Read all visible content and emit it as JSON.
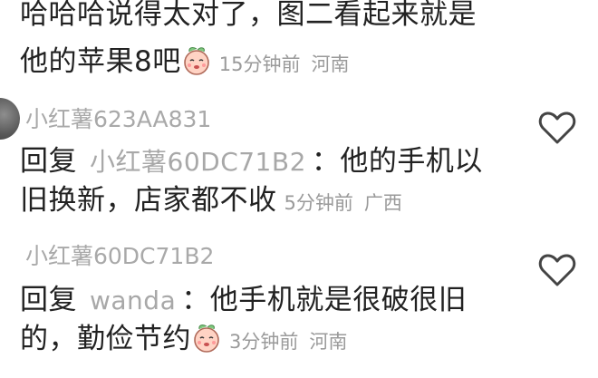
{
  "top_comment": {
    "line1": "哈哈哈说得太对了，图二看起来就是",
    "line2": "他的苹果8吧",
    "emoji_icon": "peach-face-emoji",
    "time": "15分钟前",
    "location": "河南"
  },
  "comments": [
    {
      "username": "小红薯623AA831",
      "reply_prefix": "回复",
      "reply_to": "小红薯60DC71B2",
      "line1_text": "：他的手机以",
      "line2_text": "旧换新，店家都不收",
      "time": "5分钟前",
      "location": "广西"
    },
    {
      "username": "小红薯60DC71B2",
      "reply_prefix": "回复",
      "reply_to": "wanda",
      "line1_text": "：他手机就是很破很旧",
      "line2_text": "的，勤俭节约",
      "emoji_icon": "peach-face-emoji",
      "time": "3分钟前",
      "location": "河南"
    }
  ],
  "colors": {
    "text": "#222222",
    "meta": "#9a9a9a",
    "username": "#a9a9a9",
    "heart_stroke": "#444444"
  }
}
